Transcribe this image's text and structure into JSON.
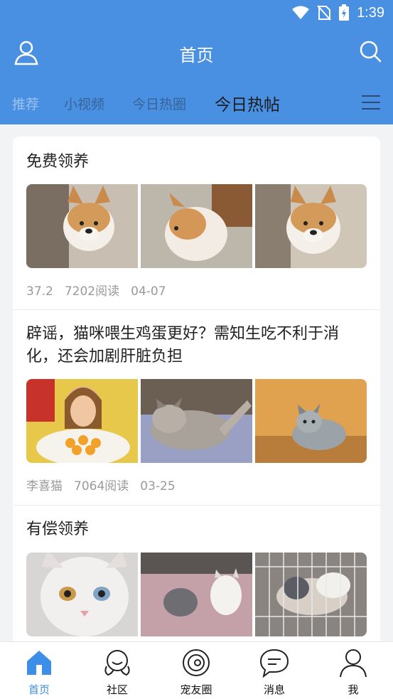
{
  "status_bar": {
    "time": "1:39",
    "icons": [
      "wifi-icon",
      "no-sim-icon",
      "battery-charging-icon"
    ]
  },
  "header": {
    "title": "首页",
    "left_icon": "user-icon",
    "right_icon": "search-icon"
  },
  "tabs": [
    {
      "label": "推荐",
      "state": "faded"
    },
    {
      "label": "小视频",
      "state": "inactive"
    },
    {
      "label": "今日热圈",
      "state": "inactive"
    },
    {
      "label": "今日热帖",
      "state": "active"
    }
  ],
  "menu_icon": "hamburger-menu-icon",
  "posts": [
    {
      "title": "免费领养",
      "images": [
        "corgi-puppy-photo",
        "corgi-puppy-photo",
        "corgi-puppy-photo"
      ],
      "meta": [
        "37.2",
        "7202阅读",
        "04-07"
      ]
    },
    {
      "title": "辟谣，猫咪喂生鸡蛋更好？需知生吃不利于消化，还会加剧肝脏负担",
      "images": [
        "woman-with-egg-bowl-photo",
        "tabby-cat-photo",
        "grey-cat-photo"
      ],
      "meta": [
        "李喜猫",
        "7064阅读",
        "03-25"
      ]
    },
    {
      "title": "有偿领养",
      "images": [
        "white-kitten-photo",
        "two-kittens-on-blanket-photo",
        "cats-in-cage-photo"
      ],
      "meta": []
    }
  ],
  "bottom_nav": [
    {
      "label": "首页",
      "icon": "home-icon",
      "active": true
    },
    {
      "label": "社区",
      "icon": "community-icon",
      "active": false
    },
    {
      "label": "宠友圈",
      "icon": "pet-circle-icon",
      "active": false
    },
    {
      "label": "消息",
      "icon": "message-icon",
      "active": false
    },
    {
      "label": "我",
      "icon": "profile-icon",
      "active": false
    }
  ],
  "colors": {
    "primary": "#4a90e2",
    "active_nav": "#3b8fe6",
    "meta_text": "#9a9a9a"
  }
}
